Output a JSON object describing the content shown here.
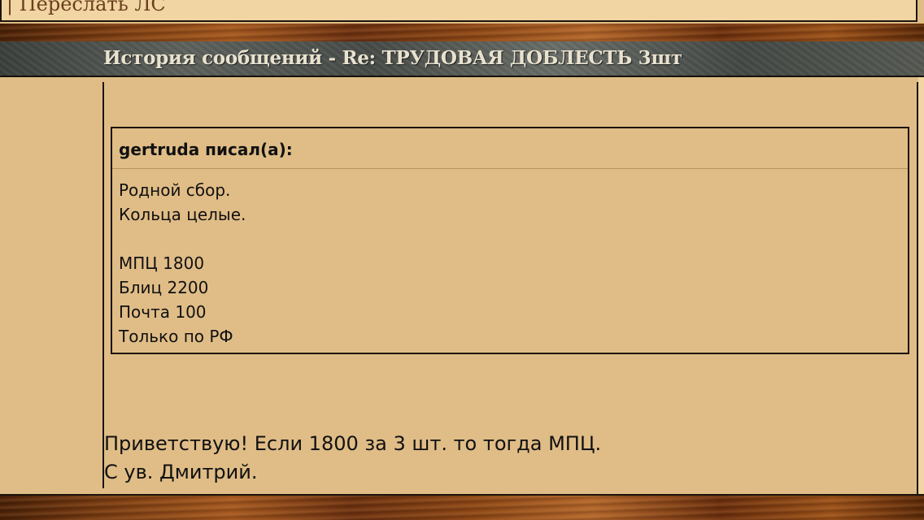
{
  "top_bar": {
    "forward_link": "| Переслать ЛС"
  },
  "header": {
    "title": "История сообщений - Re: ТРУДОВАЯ ДОБЛЕСТЬ 3шт"
  },
  "quote": {
    "author": "gertruda писал(а):",
    "lines": [
      "Родной сбор.",
      "Кольца целые.",
      "",
      "МПЦ 1800",
      "Блиц 2200",
      "Почта 100",
      "Только по РФ"
    ]
  },
  "reply": {
    "lines": [
      "Приветствую! Если 1800 за 3 шт. то тогда МПЦ.",
      "С ув. Дмитрий."
    ]
  }
}
